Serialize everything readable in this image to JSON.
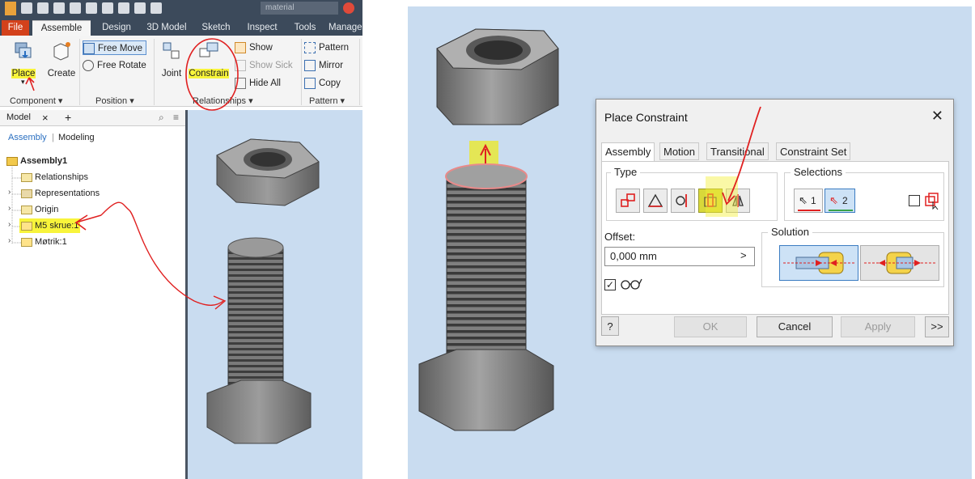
{
  "left": {
    "tabs": [
      "File",
      "Assemble",
      "Design",
      "3D Model",
      "Sketch",
      "Inspect",
      "Tools",
      "Manage"
    ],
    "search_placeholder": "material",
    "ribbon": {
      "place": "Place",
      "create": "Create",
      "free_move": "Free Move",
      "free_rotate": "Free Rotate",
      "joint": "Joint",
      "constrain": "Constrain",
      "show": "Show",
      "show_sick": "Show Sick",
      "hide_all": "Hide All",
      "pattern": "Pattern",
      "mirror": "Mirror",
      "copy": "Copy",
      "panels": {
        "component": "Component ▾",
        "position": "Position ▾",
        "relationships": "Relationships ▾",
        "pattern": "Pattern ▾"
      }
    },
    "browser": {
      "tab_model": "Model",
      "tab_close": "×",
      "tab_add": "+",
      "mode_assembly": "Assembly",
      "mode_sep": "|",
      "mode_modeling": "Modeling",
      "root": "Assembly1",
      "items": [
        "Relationships",
        "Representations",
        "Origin",
        "M5 skrue:1",
        "Møtrik:1"
      ]
    }
  },
  "dialog": {
    "title": "Place Constraint",
    "close": "✕",
    "tabs": [
      "Assembly",
      "Motion",
      "Transitional",
      "Constraint Set"
    ],
    "type_label": "Type",
    "selections_label": "Selections",
    "sel1": "1",
    "sel2": "2",
    "offset_label": "Offset:",
    "offset_value": "0,000 mm",
    "offset_arrow": ">",
    "solution_label": "Solution",
    "help": "?",
    "ok": "OK",
    "cancel": "Cancel",
    "apply": "Apply",
    "more": ">>"
  },
  "colors": {
    "highlight": "#f8f43b",
    "annotation": "#e02020",
    "viewport": "#c9dcf0",
    "file_tab": "#d3411b"
  }
}
